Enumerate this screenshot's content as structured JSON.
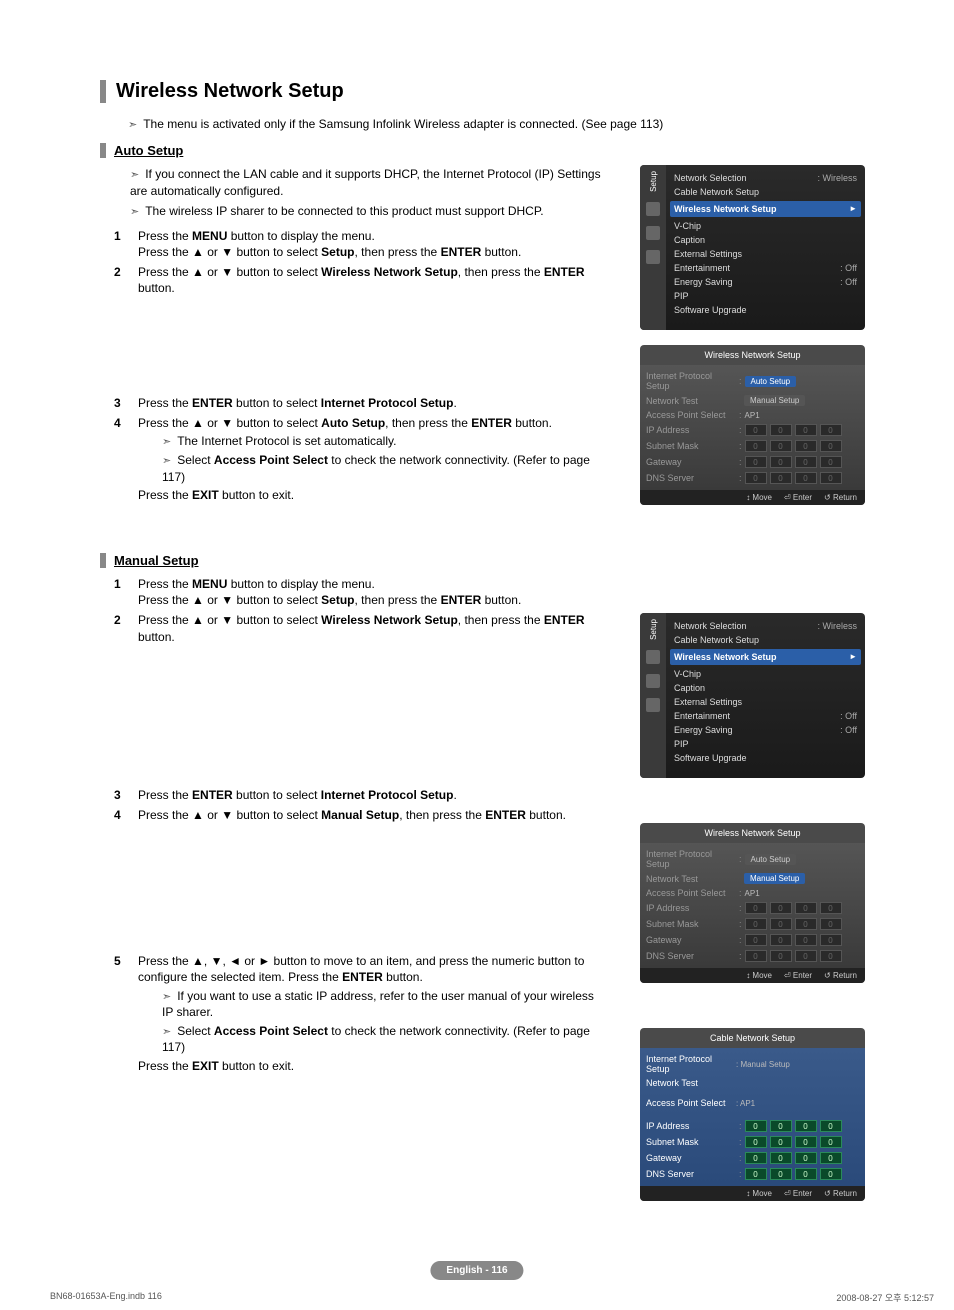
{
  "title": "Wireless Network Setup",
  "intro": "The menu is activated only if the Samsung Infolink Wireless adapter is connected. (See page 113)",
  "auto": {
    "heading": "Auto Setup",
    "note1": "If you connect the LAN cable and it supports DHCP, the Internet Protocol (IP) Settings are automatically configured.",
    "note2": "The wireless IP sharer to be connected to this product must support DHCP.",
    "s1a": "Press the ",
    "s1b": " button to display the menu.",
    "s1c": "Press the ▲ or ▼ button to select ",
    "s1d": ", then press the ",
    "s1e": " button.",
    "s2a": "Press the ▲ or ▼ button to select ",
    "s2b": ", then press the ",
    "s2c": " button.",
    "s3a": "Press the ",
    "s3b": " button to select ",
    "s3c": ".",
    "s4a": "Press the ▲ or ▼ button to select ",
    "s4b": ", then press the ",
    "s4c": " button.",
    "s4n1": "The Internet Protocol is set automatically.",
    "s4n2a": "Select ",
    "s4n2b": " to check the network connectivity. (Refer to page 117)",
    "s4exit_a": "Press the ",
    "s4exit_b": " button to exit.",
    "b_menu": "MENU",
    "b_setup": "Setup",
    "b_enter": "ENTER",
    "b_wns": "Wireless Network Setup",
    "b_ips": "Internet Protocol Setup",
    "b_auto": "Auto Setup",
    "b_aps": "Access Point Select",
    "b_exit": "EXIT"
  },
  "manual": {
    "heading": "Manual Setup",
    "s1a": "Press the ",
    "s1b": " button to display the menu.",
    "s1c": "Press the ▲ or ▼ button to select ",
    "s1d": ", then press the ",
    "s1e": " button.",
    "s2a": "Press the ▲ or ▼ button to select ",
    "s2b": ", then press the ",
    "s2c": "  button.",
    "s3a": "Press the ",
    "s3b": " button to select ",
    "s3c": ".",
    "s4a": "Press the ▲ or ▼ button to select ",
    "s4b": ", then press the ",
    "s4c": " button.",
    "s5a": "Press the ▲, ▼, ◄ or ► button to move to an item, and press the numeric button to configure the selected item. Press the ",
    "s5b": " button.",
    "s5n1": "If you want to use a static IP address, refer to the user manual of your wireless IP sharer.",
    "s5n2a": "Select ",
    "s5n2b": " to check the network connectivity. (Refer to page 117)",
    "s5exit_a": "Press the ",
    "s5exit_b": " button to exit.",
    "b_menu": "MENU",
    "b_setup": "Setup",
    "b_enter": "ENTER",
    "b_wns": "Wireless Network Setup",
    "b_ips": "Internet Protocol Setup",
    "b_manual": "Manual Setup",
    "b_aps": "Access Point Select",
    "b_exit": "EXIT"
  },
  "tv_setup_menu": {
    "sidebar_label": "Setup",
    "items": [
      {
        "label": "Network Selection",
        "value": ": Wireless"
      },
      {
        "label": "Cable Network Setup",
        "value": ""
      },
      {
        "label": "Wireless Network Setup",
        "value": "",
        "hl": true
      },
      {
        "label": "V-Chip",
        "value": ""
      },
      {
        "label": "Caption",
        "value": ""
      },
      {
        "label": "External Settings",
        "value": ""
      },
      {
        "label": "Entertainment",
        "value": ": Off"
      },
      {
        "label": "Energy Saving",
        "value": ": Off"
      },
      {
        "label": "PIP",
        "value": ""
      },
      {
        "label": "Software Upgrade",
        "value": ""
      }
    ]
  },
  "wns_auto": {
    "title": "Wireless Network Setup",
    "rows": {
      "ips": "Internet Protocol Setup",
      "nt": "Network Test",
      "aps": "Access Point Select",
      "aps_val": "AP1",
      "ip": "IP Address",
      "sm": "Subnet Mask",
      "gw": "Gateway",
      "dns": "DNS Server"
    },
    "dd_auto": "Auto Setup",
    "dd_manual": "Manual Setup",
    "zeros": [
      "0",
      "0",
      "0",
      "0"
    ],
    "footer": {
      "move": "Move",
      "enter": "Enter",
      "return": "Return"
    }
  },
  "wns_manual": {
    "title": "Wireless Network Setup",
    "dd_auto": "Auto Setup",
    "dd_manual": "Manual Setup"
  },
  "cable_panel": {
    "title": "Cable Network Setup",
    "ips": "Internet Protocol Setup",
    "ips_val": ": Manual Setup",
    "nt": "Network Test",
    "aps": "Access Point Select",
    "aps_val": ": AP1",
    "ip": "IP Address",
    "sm": "Subnet Mask",
    "gw": "Gateway",
    "dns": "DNS Server",
    "zeros": [
      "0",
      "0",
      "0",
      "0"
    ],
    "footer": {
      "move": "Move",
      "enter": "Enter",
      "return": "Return"
    }
  },
  "page_num": "English - 116",
  "doc_footer_left": "BN68-01653A-Eng.indb   116",
  "doc_footer_right": "2008-08-27   오후 5:12:57"
}
